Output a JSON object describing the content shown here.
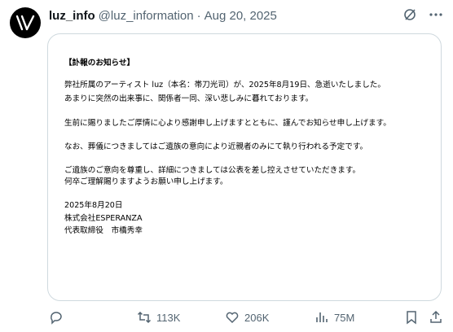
{
  "tweet": {
    "display_name": "luz_info",
    "handle": "@luz_information",
    "separator": "·",
    "date": "Aug 20, 2025"
  },
  "notice": {
    "title": "【訃報のお知らせ】",
    "lines": [
      "弊社所属のアーティスト luz（本名：帯刀光司）が、2025年8月19日、急逝いたしました。",
      "あまりに突然の出来事に、関係者一同、深い悲しみに暮れております。",
      "生前に賜りましたご厚情に心より感謝申し上げますとともに、謹んでお知らせ申し上げます。",
      "なお、葬儀につきましてはご遺族の意向により近親者のみにて執り行われる予定です。",
      "ご遺族のご意向を尊重し、詳細につきましては公表を差し控えさせていただきます。",
      "何卒ご理解賜りますようお願い申し上げます。"
    ],
    "date": "2025年8月20日",
    "company": "株式会社ESPERANZA",
    "signatory": "代表取締役　市橋秀幸"
  },
  "actions": {
    "reposts": "113K",
    "likes": "206K",
    "views": "75M"
  },
  "icons": [
    "avatar-logo",
    "grok-icon",
    "more-icon",
    "reply-icon",
    "repost-icon",
    "like-icon",
    "views-icon",
    "bookmark-icon",
    "share-icon"
  ],
  "colors": {
    "text": "#0f1419",
    "secondary": "#536471",
    "border": "#cfd9de"
  }
}
